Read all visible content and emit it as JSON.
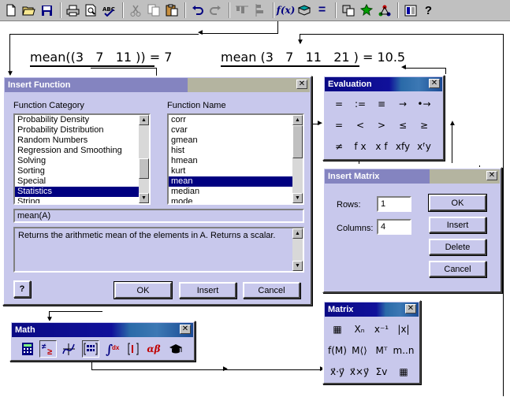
{
  "toolbar": {
    "buttons": [
      "new-doc-icon",
      "open-folder-icon",
      "save-icon",
      "print-icon",
      "print-preview-icon",
      "spellcheck-icon",
      "cut-icon",
      "copy-icon",
      "paste-icon",
      "undo-icon",
      "redo-icon",
      "align-across-icon",
      "align-down-icon",
      "insert-function-icon",
      "insert-unit-icon",
      "calculate-icon",
      "insert-component-icon",
      "run-script-icon",
      "resource-center-icon",
      "help-icon"
    ],
    "function_label": "f(x)",
    "calc_label": "="
  },
  "worksheet": {
    "expr1": "mean((3   7   11 )) = 7",
    "expr2": "mean (3   7   11   21 ) = 10.5"
  },
  "insert_function": {
    "title": "Insert Function",
    "category_label": "Function Category",
    "name_label": "Function Name",
    "categories": [
      "Probability Density",
      "Probability Distribution",
      "Random Numbers",
      "Regression and Smoothing",
      "Solving",
      "Sorting",
      "Special",
      "Statistics",
      "String"
    ],
    "selected_category": "Statistics",
    "names": [
      "corr",
      "cvar",
      "gmean",
      "hist",
      "hmean",
      "kurt",
      "mean",
      "median",
      "mode"
    ],
    "selected_name": "mean",
    "signature": "mean(A)",
    "description": "Returns the arithmetic mean of the elements in A. Returns a scalar.",
    "help_label": "?",
    "ok_label": "OK",
    "insert_label": "Insert",
    "cancel_label": "Cancel"
  },
  "evaluation": {
    "title": "Evaluation",
    "row1": [
      "=",
      ":=",
      "≡",
      "→",
      "•→"
    ],
    "row2": [
      "=",
      "<",
      ">",
      "≤",
      "≥"
    ],
    "row3": [
      "≠",
      "f x",
      "x f",
      "xfy",
      "xᶠy"
    ]
  },
  "insert_matrix": {
    "title": "Insert Matrix",
    "rows_label": "Rows:",
    "rows_value": "1",
    "columns_label": "Columns:",
    "columns_value": "4",
    "ok_label": "OK",
    "insert_label": "Insert",
    "delete_label": "Delete",
    "cancel_label": "Cancel"
  },
  "matrix_palette": {
    "title": "Matrix",
    "row1": [
      "▦",
      "Xₙ",
      "x⁻¹",
      "|x|"
    ],
    "row2": [
      "f(M)",
      "M⟨⟩",
      "Mᵀ",
      "m..n"
    ],
    "row3": [
      "x⃗·y⃗",
      "x⃗×y⃗",
      "Σv",
      "▦"
    ]
  },
  "math_toolbar": {
    "title": "Math",
    "buttons": [
      "calculator-icon",
      "evaluation-icon",
      "graph-icon",
      "matrix-icon",
      "calculus-icon",
      "boolean-icon",
      "greek-icon",
      "symbolic-icon"
    ],
    "greek_label": "αβ"
  }
}
